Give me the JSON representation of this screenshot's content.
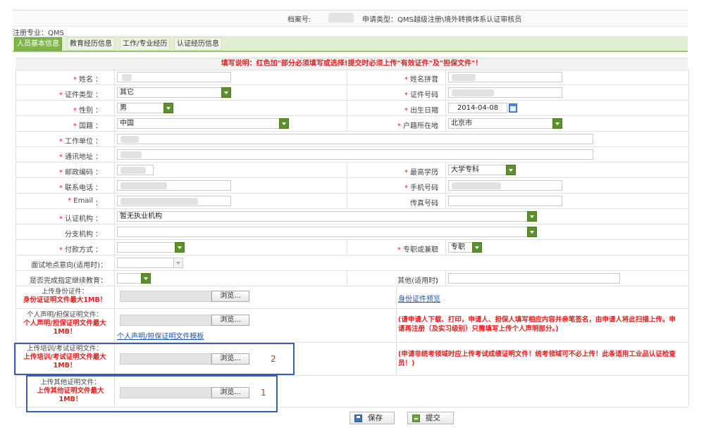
{
  "header": {
    "archive_label": "档案号:",
    "apply_type": "申请类型：QMS越级注册\\境外转换体系认证审核员"
  },
  "registration_major": "注册专业：QMS",
  "tabs": [
    {
      "label": "人员基本信息",
      "active": true
    },
    {
      "label": "教育经历信息",
      "active": false
    },
    {
      "label": "工作/专业经历",
      "active": false
    },
    {
      "label": "认证经历信息",
      "active": false
    }
  ],
  "instructions": "填写说明：红色加\"部分必须填写或选择!提交时必须上传\"有效证件\"及\"担保文件\"！",
  "fields": {
    "name": {
      "label": "姓名",
      "required": true
    },
    "name_pinyin": {
      "label": "姓名拼音",
      "required": true
    },
    "id_type": {
      "label": "证件类型",
      "required": true,
      "value": "其它"
    },
    "id_number": {
      "label": "证件号码",
      "required": true
    },
    "gender": {
      "label": "性别",
      "required": true,
      "value": "男"
    },
    "birth_date": {
      "label": "出生日期",
      "required": true,
      "value": "2014-04-08"
    },
    "nationality": {
      "label": "国籍",
      "required": true,
      "value": "中国"
    },
    "household": {
      "label": "户籍所在地",
      "required": true,
      "value": "北京市"
    },
    "employer": {
      "label": "工作单位",
      "required": true
    },
    "address": {
      "label": "通讯地址",
      "required": true
    },
    "postcode": {
      "label": "邮政编码",
      "required": true
    },
    "education": {
      "label": "最高学历",
      "required": true,
      "value": "大学专科"
    },
    "phone": {
      "label": "联系电话",
      "required": true
    },
    "mobile": {
      "label": "手机号码",
      "required": true
    },
    "email": {
      "label": "Email",
      "required": true
    },
    "fax": {
      "label": "传真号码",
      "required": false
    },
    "cert_body": {
      "label": "认证机构",
      "required": true,
      "value": "暂无执业机构"
    },
    "branch": {
      "label": "分支机构",
      "required": false
    },
    "payment": {
      "label": "付款方式",
      "required": true
    },
    "fulltime": {
      "label": "专职或兼职",
      "required": true,
      "value": "专职"
    },
    "interview_site": {
      "label": "面试地点意向(适用时)",
      "required": false
    },
    "continuing_edu": {
      "label": "是否完成指定继续教育",
      "required": false
    },
    "other": {
      "label": "其他(适用时)",
      "required": false
    }
  },
  "uploads": {
    "id_cert": {
      "label": "上传身份证件：",
      "limit": "身份证证明文件最大1MB！",
      "browse": "浏览...",
      "link": "身份证件预览"
    },
    "statement": {
      "label": "个人声明/担保证明文件：",
      "limit": "个人声明/担保证明文件最大1MB！",
      "browse": "浏览...",
      "link": "个人声明/担保证明文件模板",
      "note": "(请申请人下载、打印，申请人、担保人填写相应内容并亲笔签名，由申请人将此扫描上传。申请再注册（及实习级别）只需填写上传个人声明部分。)"
    },
    "training": {
      "label": "上传培训/考试证明文件：",
      "limit": "上传培训/考试证明文件最大1MB！",
      "browse": "浏览...",
      "note": "(申请非统考领域时应上传考试成绩证明文件！统考领域可不必上传！此条适用工业品认证检查员！)"
    },
    "other": {
      "label": "上传其他证明文件：",
      "limit": "上传其他证明文件最大1MB！",
      "browse": "浏览..."
    }
  },
  "annotations": {
    "box1": "1",
    "box2": "2"
  },
  "buttons": {
    "save": "保存",
    "submit": "提交"
  },
  "colors": {
    "required": "#e02020",
    "tab_active": "#7fb54a",
    "dropdown": "#5d8f2e",
    "annotation_box": "#3f5bb4",
    "link": "#1a55b8"
  }
}
